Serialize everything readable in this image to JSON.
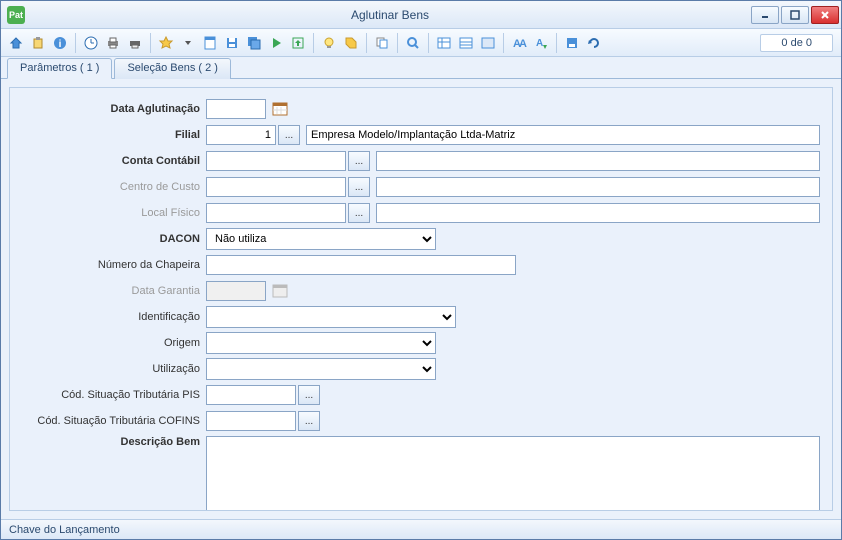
{
  "window": {
    "appicon": "Pat",
    "title": "Aglutinar Bens"
  },
  "pager": "0 de 0",
  "tabs": [
    {
      "label": "Parâmetros ( 1 )",
      "active": true
    },
    {
      "label": "Seleção Bens ( 2 )",
      "active": false
    }
  ],
  "form": {
    "data_aglutinacao": {
      "label": "Data Aglutinação",
      "value": ""
    },
    "filial": {
      "label": "Filial",
      "code": "1",
      "desc": "Empresa Modelo/Implantação Ltda-Matriz"
    },
    "conta_contabil": {
      "label": "Conta Contábil",
      "code": "",
      "desc": ""
    },
    "centro_custo": {
      "label": "Centro de Custo",
      "code": "",
      "desc": ""
    },
    "local_fisico": {
      "label": "Local Físico",
      "code": "",
      "desc": ""
    },
    "dacon": {
      "label": "DACON",
      "value": "Não utiliza"
    },
    "numero_chapeira": {
      "label": "Número da Chapeira",
      "value": ""
    },
    "data_garantia": {
      "label": "Data Garantia",
      "value": ""
    },
    "identificacao": {
      "label": "Identificação",
      "value": ""
    },
    "origem": {
      "label": "Origem",
      "value": ""
    },
    "utilizacao": {
      "label": "Utilização",
      "value": ""
    },
    "cod_pis": {
      "label": "Cód. Situação Tributária PIS",
      "value": ""
    },
    "cod_cofins": {
      "label": "Cód. Situação Tributária COFINS",
      "value": ""
    },
    "descricao": {
      "label": "Descrição Bem",
      "value": ""
    }
  },
  "status": "Chave do Lançamento",
  "lookup_glyph": "..."
}
